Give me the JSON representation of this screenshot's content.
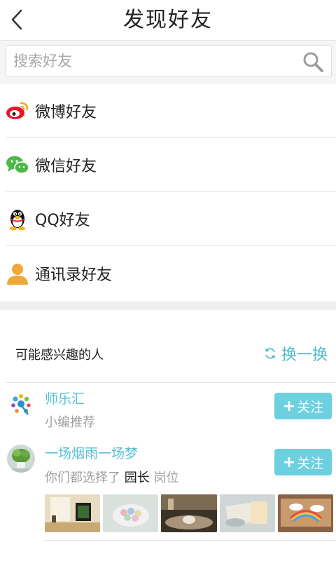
{
  "header": {
    "title": "发现好友",
    "back_icon": "chevron-left-icon"
  },
  "search": {
    "placeholder": "搜索好友",
    "value": "",
    "icon": "search-icon"
  },
  "friend_sources": [
    {
      "label": "微博好友",
      "icon": "weibo-icon",
      "color": "#e6162d"
    },
    {
      "label": "微信好友",
      "icon": "wechat-icon",
      "color": "#4cb848"
    },
    {
      "label": "QQ好友",
      "icon": "qq-penguin-icon",
      "color": "#111111"
    },
    {
      "label": "通讯录好友",
      "icon": "contact-person-icon",
      "color": "#f0a73a"
    }
  ],
  "recommend": {
    "title": "可能感兴趣的人",
    "refresh_label": "换一换",
    "people": [
      {
        "name": "师乐汇",
        "sub": "小编推荐",
        "follow_label": "关注"
      },
      {
        "name": "一场烟雨一场梦",
        "sub_prefix": "你们都选择了",
        "sub_highlight": "园长",
        "sub_suffix": "岗位",
        "follow_label": "关注"
      }
    ]
  },
  "colors": {
    "accent": "#4ab9cf",
    "follow_button": "#6cd0de",
    "divider": "#e3e3e3"
  }
}
